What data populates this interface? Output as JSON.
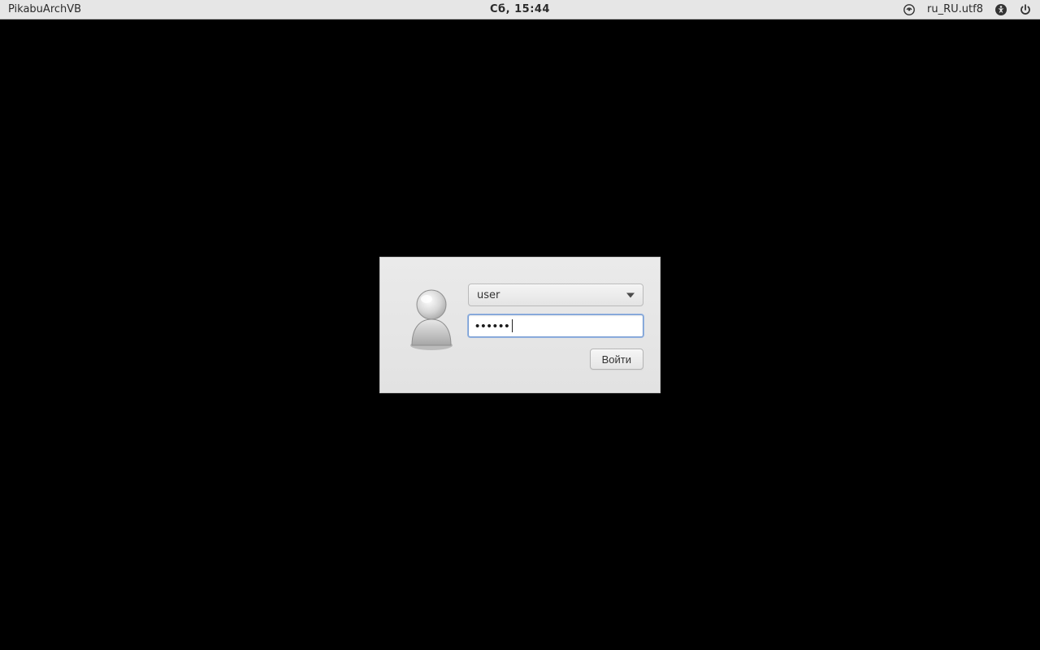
{
  "top_panel": {
    "hostname": "PikabuArchVB",
    "clock": "Сб, 15:44",
    "locale": "ru_RU.utf8"
  },
  "login": {
    "user_selected": "user",
    "password_masked": "••••••",
    "login_button": "Войти"
  }
}
